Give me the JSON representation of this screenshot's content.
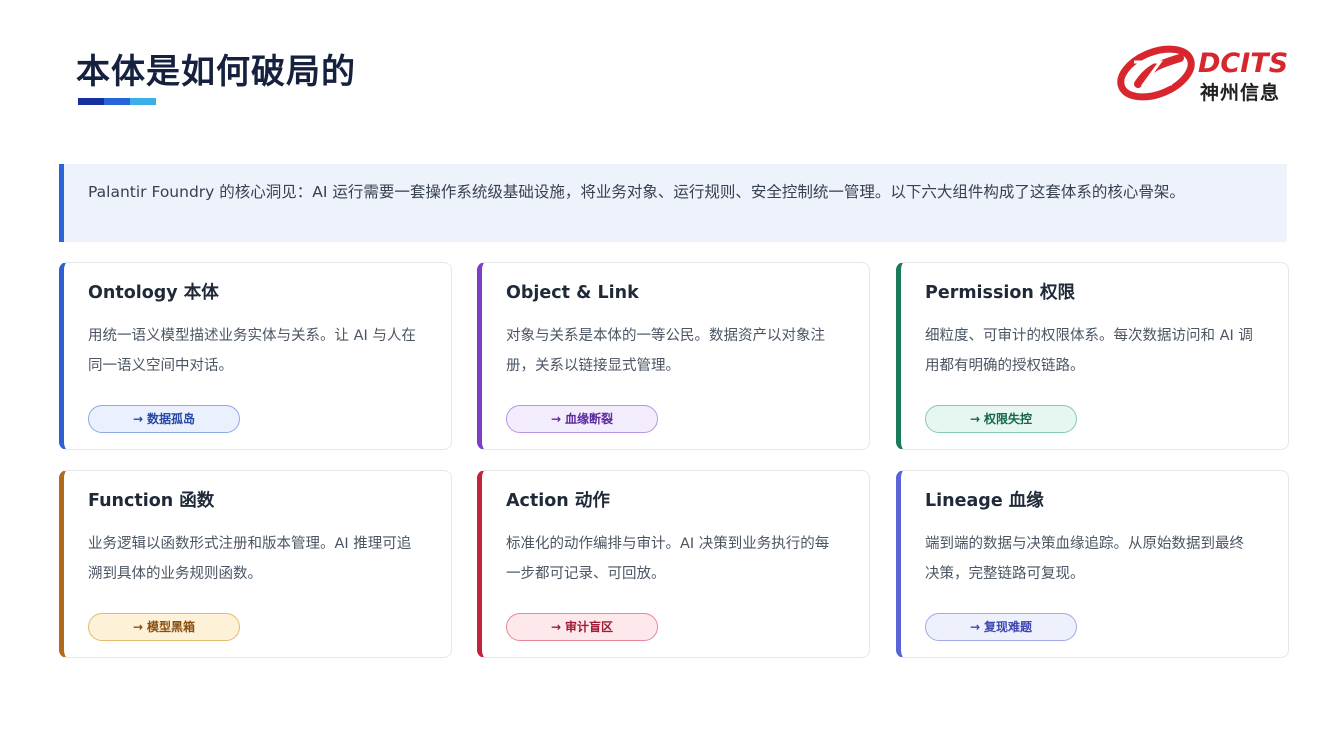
{
  "header": {
    "title": "本体是如何破局的",
    "logo_text": "DCITS",
    "logo_subtitle": "神州信息"
  },
  "intro": {
    "text": "Palantir Foundry 的核心洞见：AI 运行需要一套操作系统级基础设施，将业务对象、运行规则、安全控制统一管理。以下六大组件构成了这套体系的核心骨架。"
  },
  "colors": {
    "title_bar": [
      "#1730a0",
      "#2766d8",
      "#3bb0e8"
    ],
    "brand_red": "#d8262e",
    "intro_accent": "#2b63d9"
  },
  "cards": [
    {
      "title": "Ontology 本体",
      "desc": "用统一语义模型描述业务实体与关系。让 AI 与人在同一语义空间中对话。",
      "tag": "数据孤岛",
      "arrow": "→",
      "accent": "#2f5fd0",
      "pill_bg": "#eaf0fd",
      "pill_border": "#8fa9e6",
      "pill_text": "#2649a8"
    },
    {
      "title": "Object & Link",
      "desc": "对象与关系是本体的一等公民。数据资产以对象注册，关系以链接显式管理。",
      "tag": "血缘断裂",
      "arrow": "→",
      "accent": "#7b3fc9",
      "pill_bg": "#f3ecfc",
      "pill_border": "#b796e6",
      "pill_text": "#5b2a9e"
    },
    {
      "title": "Permission 权限",
      "desc": "细粒度、可审计的权限体系。每次数据访问和 AI 调用都有明确的授权链路。",
      "tag": "权限失控",
      "arrow": "→",
      "accent": "#1c7a5c",
      "pill_bg": "#e6f6f0",
      "pill_border": "#84cbb0",
      "pill_text": "#17664c"
    },
    {
      "title": "Function 函数",
      "desc": "业务逻辑以函数形式注册和版本管理。AI 推理可追溯到具体的业务规则函数。",
      "tag": "模型黑箱",
      "arrow": "→",
      "accent": "#b3691c",
      "pill_bg": "#fdf2d8",
      "pill_border": "#e2bb6e",
      "pill_text": "#8a4f10"
    },
    {
      "title": "Action 动作",
      "desc": "标准化的动作编排与审计。AI 决策到业务执行的每一步都可记录、可回放。",
      "tag": "审计盲区",
      "arrow": "→",
      "accent": "#c4213f",
      "pill_bg": "#fde8ec",
      "pill_border": "#e8879a",
      "pill_text": "#a01a33"
    },
    {
      "title": "Lineage 血缘",
      "desc": "端到端的数据与决策血缘追踪。从原始数据到最终决策，完整链路可复现。",
      "tag": "复现难题",
      "arrow": "→",
      "accent": "#5a63d8",
      "pill_bg": "#eef0fc",
      "pill_border": "#a3a9e8",
      "pill_text": "#3f47b0"
    }
  ]
}
